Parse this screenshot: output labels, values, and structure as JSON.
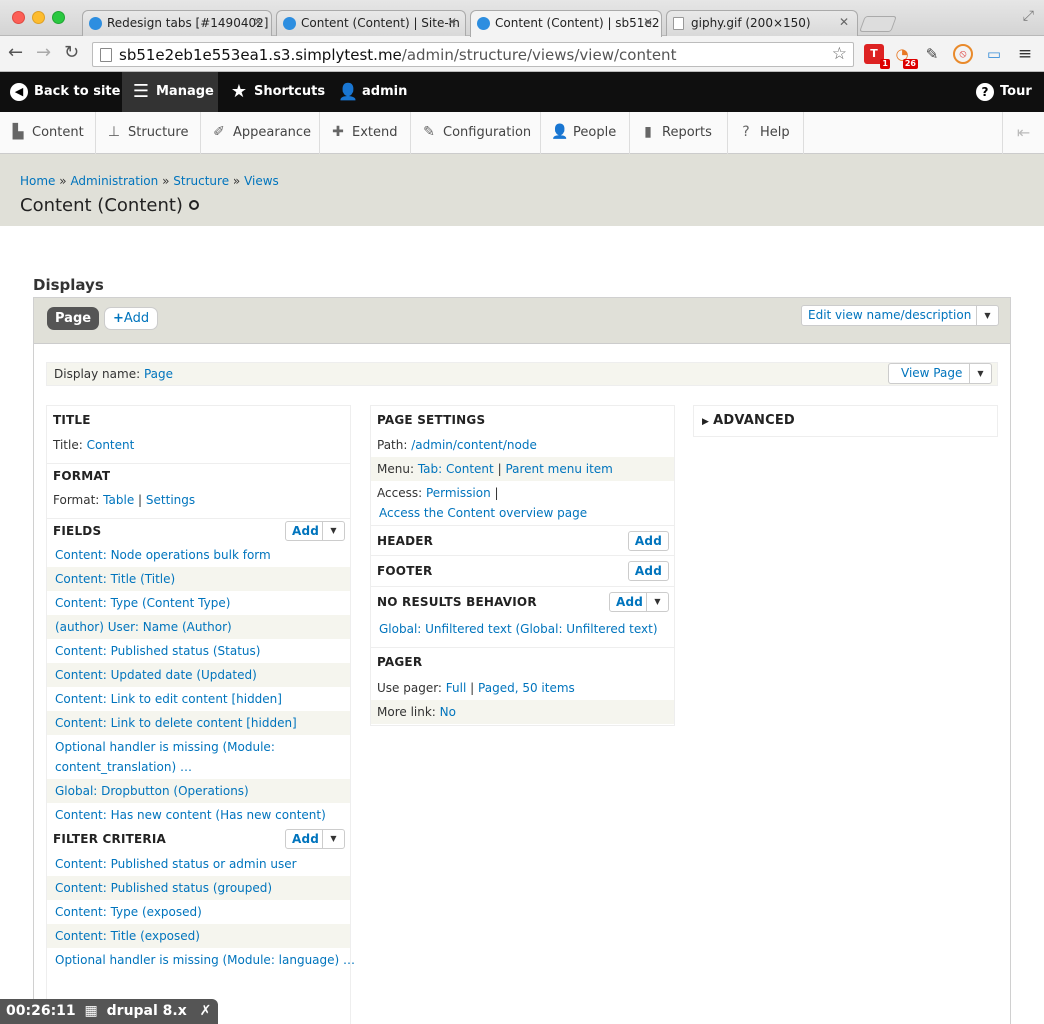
{
  "browser": {
    "tabs": [
      {
        "title": "Redesign tabs [#1490402]"
      },
      {
        "title": "Content (Content) | Site-In"
      },
      {
        "title": "Content (Content) | sb51e2"
      },
      {
        "title": "giphy.gif (200×150)"
      }
    ],
    "url_host": "sb51e2eb1e553ea1.s3.simplytest.me",
    "url_path": "/admin/structure/views/view/content",
    "badges": {
      "ext1": "1",
      "ext2": "26"
    }
  },
  "toolbar": {
    "back": "Back to site",
    "manage": "Manage",
    "shortcuts": "Shortcuts",
    "user": "admin",
    "tour": "Tour"
  },
  "tray": [
    "Content",
    "Structure",
    "Appearance",
    "Extend",
    "Configuration",
    "People",
    "Reports",
    "Help"
  ],
  "breadcrumb": [
    "Home",
    "Administration",
    "Structure",
    "Views"
  ],
  "breadcrumb_sep": "»",
  "page_title": "Content (Content)",
  "displays": {
    "heading": "Displays",
    "active_tab": "Page",
    "add_label": "Add",
    "edit_name": "Edit view name/description",
    "display_name_label": "Display name:",
    "display_name_value": "Page",
    "view_page": "View Page"
  },
  "left": {
    "title_h": "TITLE",
    "title_label": "Title:",
    "title_value": "Content",
    "format_h": "FORMAT",
    "format_label": "Format:",
    "format_value": "Table",
    "format_sep": "|",
    "format_settings": "Settings",
    "fields_h": "FIELDS",
    "add": "Add",
    "fields": [
      "Content: Node operations bulk form",
      "Content: Title (Title)",
      "Content: Type (Content Type)",
      "(author) User: Name (Author)",
      "Content: Published status (Status)",
      "Content: Updated date (Updated)",
      "Content: Link to edit content [hidden]",
      "Content: Link to delete content [hidden]",
      "Optional handler is missing (Module: content_translation) …",
      "Global: Dropbutton (Operations)",
      "Content: Has new content (Has new content)"
    ],
    "filter_h": "FILTER CRITERIA",
    "filters": [
      "Content: Published status or admin user",
      "Content: Published status (grouped)",
      "Content: Type (exposed)",
      "Content: Title (exposed)",
      "Optional handler is missing (Module: language) …"
    ]
  },
  "middle": {
    "page_settings_h": "PAGE SETTINGS",
    "path_label": "Path:",
    "path_value": "/admin/content/node",
    "menu_label": "Menu:",
    "menu_value": "Tab: Content",
    "menu_sep": "|",
    "menu_parent": "Parent menu item",
    "access_label": "Access:",
    "access_value": "Permission",
    "access_sep": "|",
    "access_detail": "Access the Content overview page",
    "header_h": "HEADER",
    "footer_h": "FOOTER",
    "noresults_h": "NO RESULTS BEHAVIOR",
    "noresults_item": "Global: Unfiltered text (Global: Unfiltered text)",
    "pager_h": "PAGER",
    "use_pager_label": "Use pager:",
    "use_pager_value": "Full",
    "pager_sep": "|",
    "pager_items": "Paged, 50 items",
    "more_link_label": "More link:",
    "more_link_value": "No",
    "add": "Add"
  },
  "right": {
    "advanced_h": "ADVANCED"
  },
  "overlay": {
    "timer": "00:26:11",
    "label": "drupal 8.x"
  }
}
